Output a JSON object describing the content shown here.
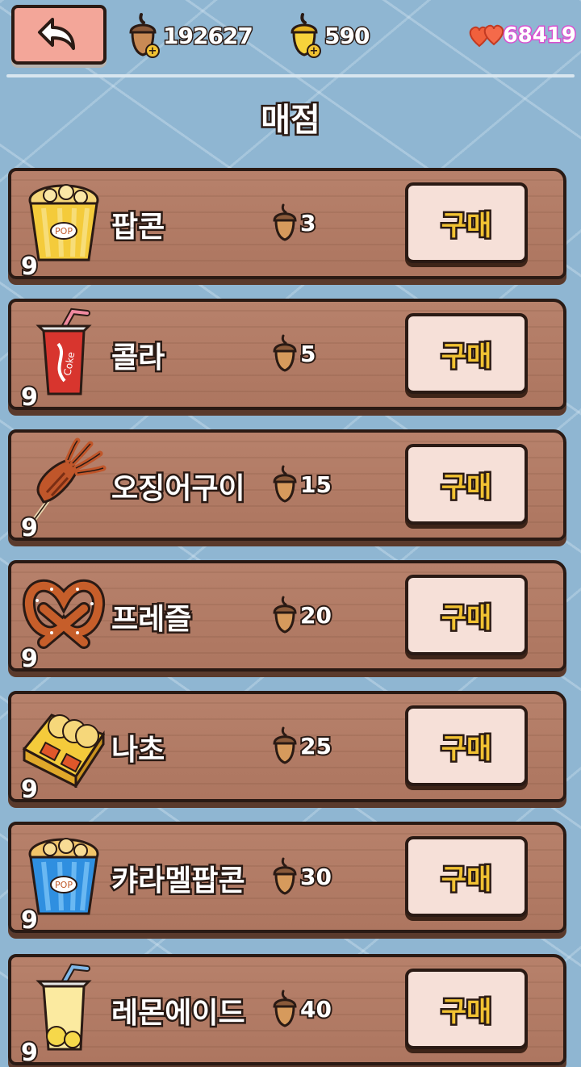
{
  "header": {
    "back_icon": "back-arrow-icon",
    "acorn_brown": {
      "icon": "acorn-brown-icon",
      "value": "192627"
    },
    "acorn_gold": {
      "icon": "acorn-gold-icon",
      "value": "590"
    },
    "hearts": {
      "icon": "hearts-icon",
      "value": "68419"
    },
    "title": "매점"
  },
  "shop": {
    "items": [
      {
        "name": "팝콘",
        "count": "9",
        "price": "3",
        "buy_label": "구매",
        "icon": "popcorn-icon"
      },
      {
        "name": "콜라",
        "count": "9",
        "price": "5",
        "buy_label": "구매",
        "icon": "cola-icon"
      },
      {
        "name": "오징어구이",
        "count": "9",
        "price": "15",
        "buy_label": "구매",
        "icon": "grilled-squid-icon"
      },
      {
        "name": "프레즐",
        "count": "9",
        "price": "20",
        "buy_label": "구매",
        "icon": "pretzel-icon"
      },
      {
        "name": "나초",
        "count": "9",
        "price": "25",
        "buy_label": "구매",
        "icon": "nachos-icon"
      },
      {
        "name": "캬라멜팝콘",
        "count": "9",
        "price": "30",
        "buy_label": "구매",
        "icon": "caramel-popcorn-icon"
      },
      {
        "name": "레몬에이드",
        "count": "9",
        "price": "40",
        "buy_label": "구매",
        "icon": "lemonade-icon"
      }
    ]
  },
  "colors": {
    "background": "#8fb6d2",
    "plank": "#b07862",
    "buy_button": "#f6e0d8",
    "buy_text": "#f1c232",
    "back_button": "#f3a699"
  }
}
